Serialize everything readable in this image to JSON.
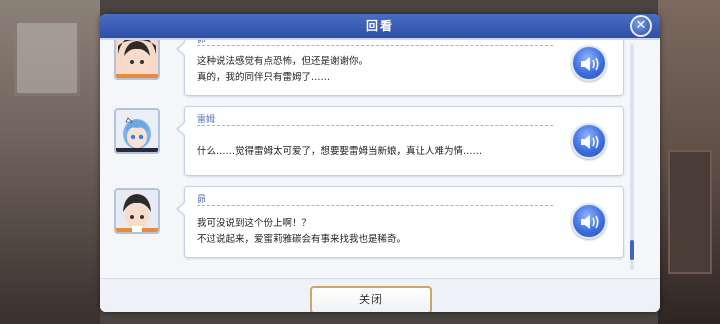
{
  "dialog": {
    "title": "回看",
    "close_button_label": "关闭"
  },
  "entries": [
    {
      "speaker": "昴",
      "lines": [
        "这种说法感觉有点恐怖，但还是谢谢你。",
        "真的，我的同伴只有雷姆了……"
      ],
      "avatar": "subaru"
    },
    {
      "speaker": "雷姆",
      "lines": [
        "什么……觉得雷姆太可爱了，想要娶雷姆当新娘，真让人难为情……"
      ],
      "avatar": "rem"
    },
    {
      "speaker": "昴",
      "lines": [
        "我可没说到这个份上啊！？",
        "不过说起来，爱蜜莉雅碳会有事来找我也是稀奇。"
      ],
      "avatar": "subaru"
    }
  ],
  "scroll": {
    "position": 0.95
  },
  "colors": {
    "title_bar": "#2d4fa6",
    "accent": "#3e6ee0",
    "button_border": "#c9a865"
  }
}
